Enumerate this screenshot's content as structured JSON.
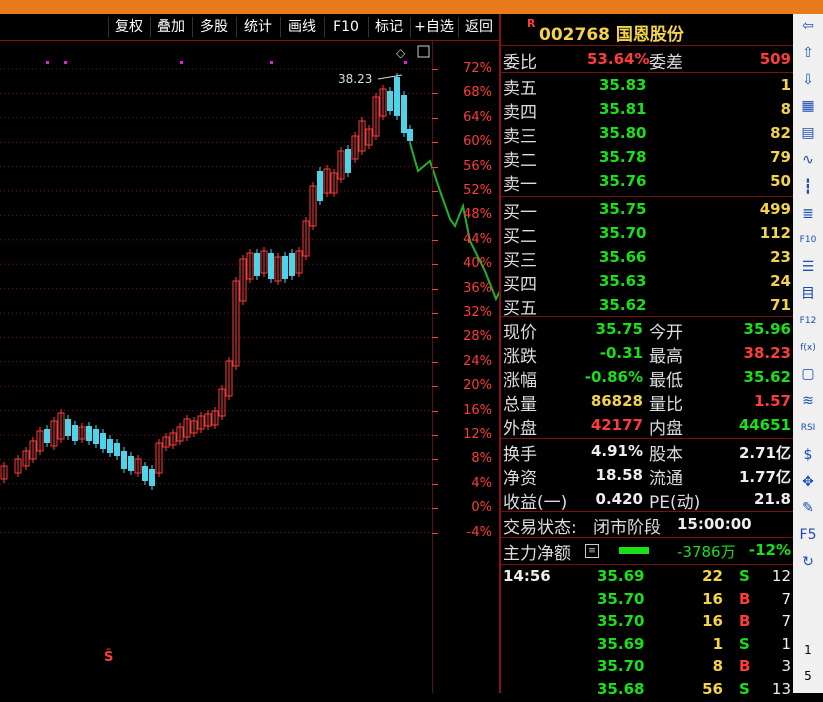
{
  "toolbar": {
    "buttons": [
      "复权",
      "叠加",
      "多股",
      "统计",
      "画线",
      "F10",
      "标记",
      "+自选",
      "返回"
    ]
  },
  "chart": {
    "high_label": "38.23",
    "pct_axis": [
      "72%",
      "68%",
      "64%",
      "60%",
      "56%",
      "52%",
      "48%",
      "44%",
      "40%",
      "36%",
      "32%",
      "28%",
      "24%",
      "20%",
      "16%",
      "12%",
      "8%",
      "4%",
      "0%",
      "-4%"
    ],
    "marker": "Ŝ"
  },
  "stock": {
    "badge": "R",
    "code_name": "002768 国恩股份"
  },
  "order_book": {
    "weibi_label": "委比",
    "weibi_value": "53.64%",
    "weicha_label": "委差",
    "weicha_value": "509",
    "asks": [
      {
        "label": "卖五",
        "price": "35.83",
        "vol": "1"
      },
      {
        "label": "卖四",
        "price": "35.81",
        "vol": "8"
      },
      {
        "label": "卖三",
        "price": "35.80",
        "vol": "82"
      },
      {
        "label": "卖二",
        "price": "35.78",
        "vol": "79"
      },
      {
        "label": "卖一",
        "price": "35.76",
        "vol": "50"
      }
    ],
    "bids": [
      {
        "label": "买一",
        "price": "35.75",
        "vol": "499"
      },
      {
        "label": "买二",
        "price": "35.70",
        "vol": "112"
      },
      {
        "label": "买三",
        "price": "35.66",
        "vol": "23"
      },
      {
        "label": "买四",
        "price": "35.63",
        "vol": "24"
      },
      {
        "label": "买五",
        "price": "35.62",
        "vol": "71"
      }
    ]
  },
  "quote": {
    "rows": [
      {
        "l1": "现价",
        "v1": "35.75",
        "c1": "green",
        "l2": "今开",
        "v2": "35.96",
        "c2": "green"
      },
      {
        "l1": "涨跌",
        "v1": "-0.31",
        "c1": "green",
        "l2": "最高",
        "v2": "38.23",
        "c2": "red"
      },
      {
        "l1": "涨幅",
        "v1": "-0.86%",
        "c1": "green",
        "l2": "最低",
        "v2": "35.62",
        "c2": "green"
      },
      {
        "l1": "总量",
        "v1": "86828",
        "c1": "yellow",
        "l2": "量比",
        "v2": "1.57",
        "c2": "red"
      },
      {
        "l1": "外盘",
        "v1": "42177",
        "c1": "red",
        "l2": "内盘",
        "v2": "44651",
        "c2": "green"
      }
    ],
    "rows2": [
      {
        "l1": "换手",
        "v1": "4.91%",
        "l2": "股本",
        "v2": "2.71亿"
      },
      {
        "l1": "净资",
        "v1": "18.58",
        "l2": "流通",
        "v2": "1.77亿"
      },
      {
        "l1": "收益(一)",
        "v1": "0.420",
        "l2": "PE(动)",
        "v2": "21.8"
      }
    ],
    "status_label": "交易状态:",
    "status_value": "闭市阶段",
    "status_time": "15:00:00",
    "mainforce_label": "主力净额",
    "mainforce_value": "-3786万",
    "mainforce_pct": "-12%"
  },
  "trades": [
    {
      "time": "14:56",
      "price": "35.69",
      "vol": "22",
      "side": "S",
      "n": "12"
    },
    {
      "time": "",
      "price": "35.70",
      "vol": "16",
      "side": "B",
      "n": "7"
    },
    {
      "time": "",
      "price": "35.70",
      "vol": "16",
      "side": "B",
      "n": "7"
    },
    {
      "time": "",
      "price": "35.69",
      "vol": "1",
      "side": "S",
      "n": "1"
    },
    {
      "time": "",
      "price": "35.70",
      "vol": "8",
      "side": "B",
      "n": "3"
    },
    {
      "time": "",
      "price": "35.68",
      "vol": "56",
      "side": "S",
      "n": "13"
    }
  ],
  "sidebar": {
    "icons": [
      "arrow-left-icon",
      "arrow-up-icon",
      "arrow-down-icon",
      "grid-icon",
      "table-icon",
      "line-chart-icon",
      "kline-icon",
      "list-icon",
      "f10-icon",
      "calendar-icon",
      "note-icon",
      "f12-icon",
      "function-icon",
      "box-icon",
      "wave-icon",
      "rsi-icon",
      "dollar-icon",
      "move-icon",
      "pen-icon",
      "f5-icon",
      "refresh-icon"
    ],
    "labels": [
      "⇦",
      "⇧",
      "⇩",
      "▦",
      "▤",
      "∿",
      "┇",
      "≣",
      "F10",
      "☰",
      "目",
      "F12",
      "f(x)",
      "▢",
      "≋",
      "RSI",
      "$",
      "✥",
      "✎",
      "F5",
      "↻"
    ],
    "num1": "1",
    "num2": "5"
  }
}
